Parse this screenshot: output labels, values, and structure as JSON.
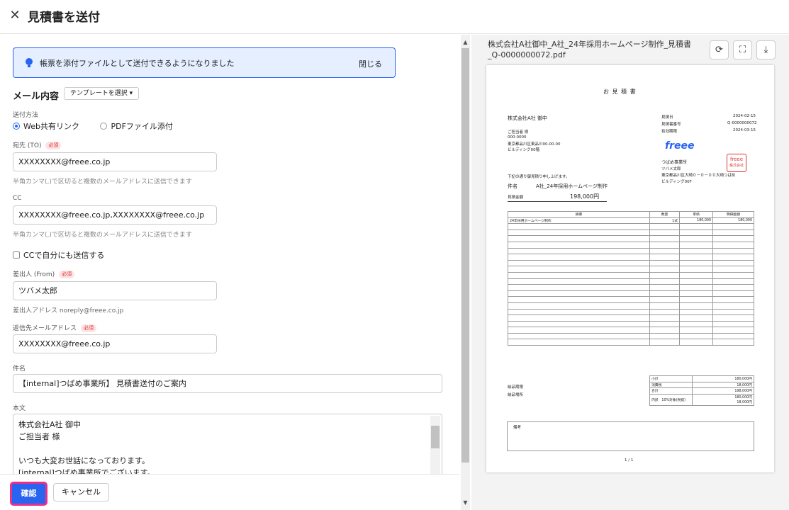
{
  "header": {
    "title": "見積書を送付",
    "close_icon": "close-icon"
  },
  "notice": {
    "message": "帳票を添付ファイルとして送付できるようになりました",
    "close": "閉じる",
    "icon": "lightbulb-icon",
    "color": "#2864f0"
  },
  "mail": {
    "section_title": "メール内容",
    "template_button": "テンプレートを選択",
    "send_method_label": "送付方法",
    "send_methods": [
      "Web共有リンク",
      "PDFファイル添付"
    ],
    "selected_method": "Web共有リンク",
    "to_label": "宛先 (TO)",
    "required": "必須",
    "to_value": "XXXXXXXX@freee.co.jp",
    "to_hint": "半角カンマ(,)で区切ると複数のメールアドレスに送信できます",
    "cc_label": "CC",
    "cc_value": "XXXXXXXX@freee.co.jp,XXXXXXXX@freee.co.jp",
    "cc_hint": "半角カンマ(,)で区切ると複数のメールアドレスに送信できます",
    "cc_self": "CCで自分にも送信する",
    "from_label": "差出人 (From)",
    "from_value": "ツバメ太郎",
    "from_address": "差出人アドレス noreply@freee.co.jp",
    "reply_label": "返信先メールアドレス",
    "reply_value": "XXXXXXXX@freee.co.jp",
    "subject_label": "件名",
    "subject_value": "【internal]つばめ事業所】 見積書送付のご案内",
    "body_label": "本文",
    "body_lines": [
      "株式会社A社 御中",
      "ご担当者 様",
      "",
      "いつも大変お世話になっております。",
      "[internal]つばめ事業所でございます。"
    ]
  },
  "footer": {
    "confirm": "確認",
    "cancel": "キャンセル",
    "accent": "#2864f0",
    "highlight": "#e8318c"
  },
  "preview": {
    "filename": "株式会社A社御中_A社_24年採用ホームページ制作_見積書_Q-0000000072.pdf",
    "buttons": [
      "reload-icon",
      "fullscreen-icon",
      "download-icon"
    ],
    "doc": {
      "title": "お 見 積 書",
      "client": "株式会社A社 御中",
      "contact": "ご担当者 様",
      "postal": "000-0000",
      "address1": "東京都品川区東品川00-00-00",
      "address2": "ビルディング00階",
      "meta": [
        [
          "見積日",
          "2024-02-15"
        ],
        [
          "見積書番号",
          "Q-0000000072"
        ],
        [
          "有効期限",
          "2024-03-15"
        ]
      ],
      "logo": "freee",
      "company": "つばめ事業所",
      "company_sub": "ツバメ太郎",
      "company_addr": "東京都品川区大崎０－０－００大崎つばめ",
      "company_addr2": "ビルディング00F",
      "stamp": [
        "freee",
        "株式会社"
      ],
      "intro": "下記の通り御見積り申し上げます。",
      "subject_label": "件名",
      "subject": "A社_24年採用ホームページ制作",
      "amount_label": "見積金額",
      "amount": "198,000円",
      "columns": [
        "摘要",
        "数量",
        "単価",
        "明細金額"
      ],
      "rows": [
        [
          "24年採用ホームページ制作",
          "1式",
          "180,000",
          "180,000"
        ]
      ],
      "left_notes": [
        "納品期限",
        "納品場所"
      ],
      "totals": [
        [
          "小計",
          "180,000円"
        ],
        [
          "消費税",
          "18,000円"
        ],
        [
          "合計",
          "198,000円"
        ],
        [
          "内訳　10%対象(税抜)",
          "180,000円"
        ]
      ],
      "totals_sub": "18,000円",
      "remarks": "備考",
      "page": "1 / 1"
    }
  }
}
